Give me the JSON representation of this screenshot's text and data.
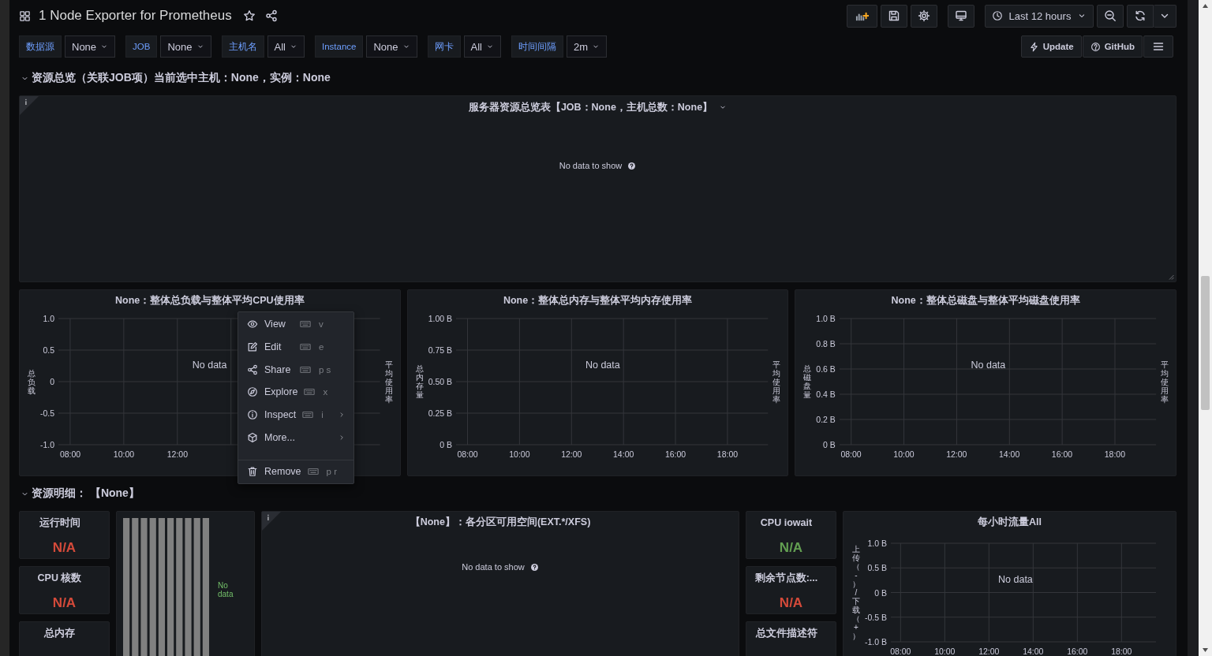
{
  "dashboard": {
    "title": "1 Node Exporter for Prometheus",
    "starred": false
  },
  "time_picker": {
    "label": "Last 12 hours"
  },
  "variables": [
    {
      "label": "数据源",
      "value": "None"
    },
    {
      "label": "JOB",
      "value": "None"
    },
    {
      "label": "主机名",
      "value": "All"
    },
    {
      "label": "Instance",
      "value": "None"
    },
    {
      "label": "网卡",
      "value": "All"
    },
    {
      "label": "时间间隔",
      "value": "2m"
    }
  ],
  "links": [
    {
      "kind": "update",
      "label": "Update"
    },
    {
      "kind": "help",
      "label": "GitHub"
    }
  ],
  "overview": {
    "row": {
      "title": "资源总览（关联JOB项）当前选中主机：None，实例：None",
      "expanded": true
    },
    "table_panel": {
      "title": "服务器资源总览表【JOB：None，主机总数：None】",
      "message": "No data to show"
    },
    "charts": [
      {
        "title": "None：整体总负载与整体平均CPU使用率",
        "y_label": "总负载",
        "y_label_right": "平均使用率",
        "y_ticks": [
          "1.0",
          "0.5",
          "0",
          "-0.5",
          "-1.0"
        ],
        "x_ticks": [
          "08:00",
          "10:00",
          "12:00"
        ],
        "message": "No data"
      },
      {
        "title": "None：整体总内存与整体平均内存使用率",
        "y_label": "总内存量",
        "y_label_right": "平均使用率",
        "y_ticks": [
          "1.00 B",
          "0.75 B",
          "0.50 B",
          "0.25 B",
          "0 B"
        ],
        "x_ticks": [
          "08:00",
          "10:00",
          "12:00",
          "14:00",
          "16:00",
          "18:00"
        ],
        "message": "No data"
      },
      {
        "title": "None：整体总磁盘与整体平均磁盘使用率",
        "y_label": "总磁盘量",
        "y_label_right": "平均使用率",
        "y_ticks": [
          "1.0 B",
          "0.8 B",
          "0.6 B",
          "0.4 B",
          "0.2 B",
          "0 B"
        ],
        "x_ticks": [
          "08:00",
          "10:00",
          "12:00",
          "14:00",
          "16:00",
          "18:00"
        ],
        "message": "No data"
      }
    ]
  },
  "context_menu": {
    "items": [
      {
        "kind": "view",
        "label": "View",
        "shortcut": "v",
        "submenu": false
      },
      {
        "kind": "edit",
        "label": "Edit",
        "shortcut": "e",
        "submenu": false
      },
      {
        "kind": "share",
        "label": "Share",
        "shortcut": "p s",
        "submenu": false
      },
      {
        "kind": "explore",
        "label": "Explore",
        "shortcut": "x",
        "submenu": false
      },
      {
        "kind": "inspect",
        "label": "Inspect",
        "shortcut": "i",
        "submenu": true
      },
      {
        "kind": "more",
        "label": "More...",
        "submenu": true
      }
    ],
    "footer_items": [
      {
        "kind": "remove",
        "label": "Remove",
        "shortcut": "p r",
        "submenu": false
      }
    ]
  },
  "details": {
    "row": {
      "title": "资源明细： 【None】",
      "expanded": true
    },
    "stats_left": [
      {
        "title": "运行时间",
        "value": "N/A",
        "color": "#d44a3a"
      },
      {
        "title": "CPU 核数",
        "value": "N/A",
        "color": "#d44a3a"
      },
      {
        "title": "总内存"
      }
    ],
    "bar_gauge": {
      "message": "No data"
    },
    "partition_panel": {
      "title": "【None】：各分区可用空间(EXT.*/XFS)",
      "message": "No data to show"
    },
    "stats_right": [
      {
        "title": "CPU iowait",
        "value": "N/A",
        "color": "#629e51"
      },
      {
        "title": "剩余节点数:...",
        "value": "N/A",
        "color": "#d44a3a"
      },
      {
        "title": "总文件描述符"
      }
    ],
    "traffic_chart": {
      "title": "每小时流量All",
      "y_label": "上传（-）/下载（+）",
      "y_ticks": [
        "1.0 B",
        "0.5 B",
        "0 B",
        "-0.5 B",
        "-1.0 B"
      ],
      "x_ticks": [
        "08:00",
        "10:00",
        "12:00",
        "14:00",
        "16:00",
        "18:00"
      ],
      "message": "No data"
    }
  }
}
